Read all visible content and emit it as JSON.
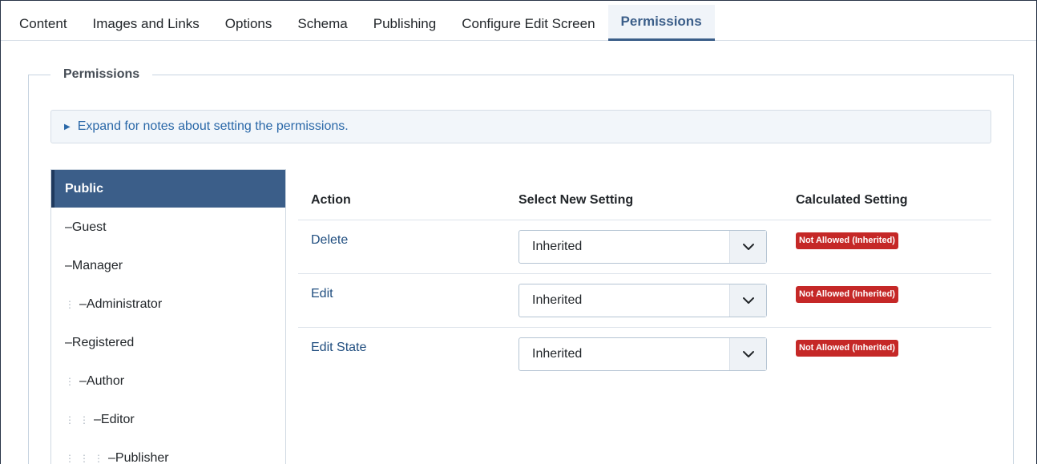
{
  "tabs": [
    {
      "label": "Content",
      "active": false
    },
    {
      "label": "Images and Links",
      "active": false
    },
    {
      "label": "Options",
      "active": false
    },
    {
      "label": "Schema",
      "active": false
    },
    {
      "label": "Publishing",
      "active": false
    },
    {
      "label": "Configure Edit Screen",
      "active": false
    },
    {
      "label": "Permissions",
      "active": true
    }
  ],
  "fieldset": {
    "legend": "Permissions"
  },
  "notes": {
    "label": "Expand for notes about setting the permissions.",
    "icon": "triangle-right-icon"
  },
  "groups": [
    {
      "label": "Public",
      "depth": 0,
      "prefix": "",
      "active": true
    },
    {
      "label": "Guest",
      "depth": 0,
      "prefix": "– ",
      "active": false
    },
    {
      "label": "Manager",
      "depth": 0,
      "prefix": "– ",
      "active": false
    },
    {
      "label": "Administrator",
      "depth": 1,
      "prefix": "– ",
      "active": false
    },
    {
      "label": "Registered",
      "depth": 0,
      "prefix": "– ",
      "active": false
    },
    {
      "label": "Author",
      "depth": 1,
      "prefix": "– ",
      "active": false
    },
    {
      "label": "Editor",
      "depth": 2,
      "prefix": "– ",
      "active": false
    },
    {
      "label": "Publisher",
      "depth": 3,
      "prefix": "– ",
      "active": false
    }
  ],
  "table": {
    "headers": {
      "action": "Action",
      "select": "Select New Setting",
      "calculated": "Calculated Setting"
    },
    "rows": [
      {
        "action": "Delete",
        "setting": "Inherited",
        "calculated": "Not Allowed (Inherited)"
      },
      {
        "action": "Edit",
        "setting": "Inherited",
        "calculated": "Not Allowed (Inherited)"
      },
      {
        "action": "Edit State",
        "setting": "Inherited",
        "calculated": "Not Allowed (Inherited)"
      }
    ]
  },
  "colors": {
    "accent": "#3b5e89",
    "badge": "#c52827",
    "link": "#1f4d7f"
  }
}
